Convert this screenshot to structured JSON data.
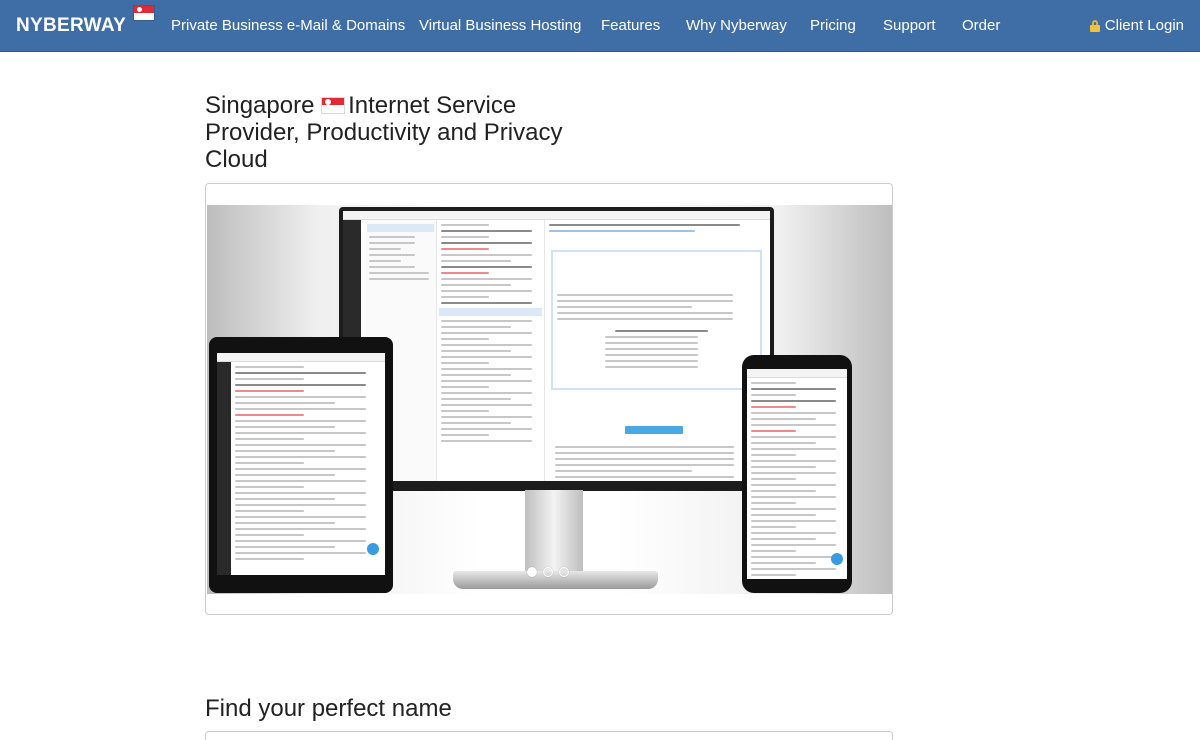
{
  "navbar": {
    "brand": "NYBERWAY",
    "links": [
      "Private Business e-Mail & Domains",
      "Virtual Business Hosting",
      "Features",
      "Why Nyberway",
      "Pricing",
      "Support",
      "Order"
    ],
    "client_login": "Client Login",
    "brand_color": "#3f6ea6"
  },
  "hero": {
    "title_part1": "Singapore",
    "title_part2": "Internet Service Provider, Productivity and Privacy Cloud"
  },
  "carousel": {
    "slides": 3,
    "active_slide": 1
  },
  "section2": {
    "title": "Find your perfect name"
  }
}
